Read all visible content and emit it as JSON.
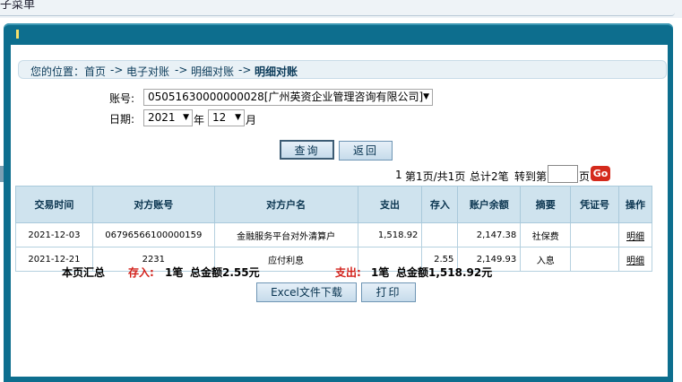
{
  "top_tab": "子菜单",
  "breadcrumb": {
    "prefix": "您的位置：",
    "items": [
      "首页",
      "电子对账",
      "明细对账"
    ],
    "separator": "->",
    "current": "明细对账"
  },
  "form": {
    "account_label": "账号:",
    "account_value": "05051630000000028[广州英资企业管理咨询有限公司]",
    "date_label": "日期:",
    "year_value": "2021",
    "year_unit": "年",
    "month_value": "12",
    "month_unit": "月"
  },
  "buttons": {
    "query": "查询",
    "back": "返回",
    "excel": "Excel文件下载",
    "print": "打印"
  },
  "pager": {
    "current": "1",
    "text1": "第1页/共1页",
    "text2": "总计2笔",
    "text3": "转到第",
    "text4": "页",
    "go": "Go"
  },
  "table": {
    "headers": [
      "交易时间",
      "对方账号",
      "对方户名",
      "支出",
      "存入",
      "账户余额",
      "摘要",
      "凭证号",
      "操作"
    ],
    "rows": [
      [
        "2021-12-03",
        "06796566100000159",
        "金融服务平台对外清算户",
        "1,518.92",
        "",
        "2,147.38",
        "社保费",
        "",
        "明细"
      ],
      [
        "2021-12-21",
        "2231",
        "应付利息",
        "",
        "2.55",
        "2,149.93",
        "入息",
        "",
        "明细"
      ]
    ]
  },
  "summary": {
    "label": "本页汇总",
    "deposit_label": "存入:",
    "deposit_count": "1笔",
    "deposit_total": "总金额2.55元",
    "payout_label": "支出:",
    "payout_count": "1笔",
    "payout_total": "总金额1,518.92元"
  },
  "colors": {
    "frame": "#0d6e8e",
    "header_bg": "#cfe3ee",
    "accent_red": "#d2201a",
    "page_num": "#e2761a"
  }
}
